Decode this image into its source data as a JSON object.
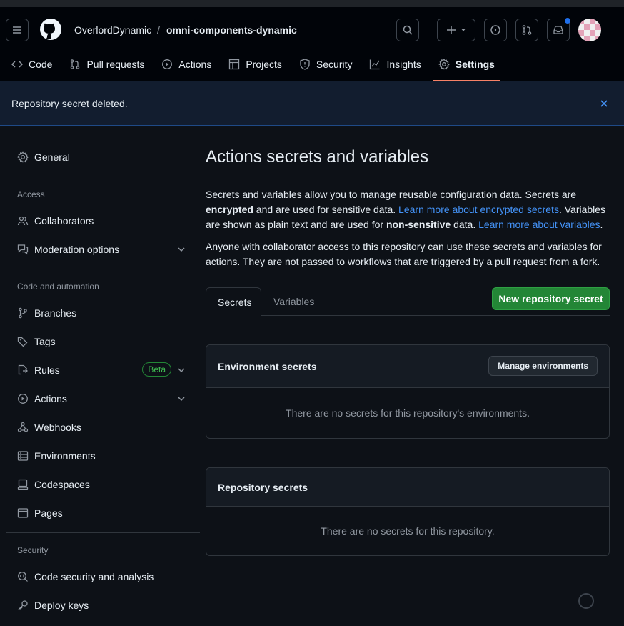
{
  "header": {
    "owner": "OverlordDynamic",
    "separator": "/",
    "repo": "omni-components-dynamic",
    "tabs": [
      {
        "label": "Code",
        "icon": "code-icon"
      },
      {
        "label": "Pull requests",
        "icon": "pull-request-icon"
      },
      {
        "label": "Actions",
        "icon": "play-icon"
      },
      {
        "label": "Projects",
        "icon": "table-icon"
      },
      {
        "label": "Security",
        "icon": "shield-icon"
      },
      {
        "label": "Insights",
        "icon": "graph-icon"
      },
      {
        "label": "Settings",
        "icon": "gear-icon"
      }
    ],
    "active_tab": "Settings"
  },
  "flash": {
    "message": "Repository secret deleted."
  },
  "sidebar": {
    "general": "General",
    "section_access": "Access",
    "collaborators": "Collaborators",
    "moderation": "Moderation options",
    "section_code": "Code and automation",
    "branches": "Branches",
    "tags": "Tags",
    "rules": "Rules",
    "beta": "Beta",
    "actions": "Actions",
    "webhooks": "Webhooks",
    "environments": "Environments",
    "codespaces": "Codespaces",
    "pages": "Pages",
    "section_security": "Security",
    "code_security": "Code security and analysis",
    "deploy_keys": "Deploy keys"
  },
  "main": {
    "title": "Actions secrets and variables",
    "p1_a": "Secrets and variables allow you to manage reusable configuration data. Secrets are ",
    "p1_b": "encrypted",
    "p1_c": " and are used for sensitive data. ",
    "p1_link1": "Learn more about encrypted secrets",
    "p1_d": ". Variables are shown as plain text and are used for ",
    "p1_e": "non-sensitive",
    "p1_f": " data. ",
    "p1_link2": "Learn more about variables",
    "p1_g": ".",
    "p2": "Anyone with collaborator access to this repository can use these secrets and variables for actions. They are not passed to workflows that are triggered by a pull request from a fork.",
    "tab_secrets": "Secrets",
    "tab_variables": "Variables",
    "new_secret": "New repository secret",
    "env_title": "Environment secrets",
    "manage_env": "Manage environments",
    "env_empty": "There are no secrets for this repository's environments.",
    "repo_title": "Repository secrets",
    "repo_empty": "There are no secrets for this repository."
  },
  "colors": {
    "accent_tab": "#f78166",
    "link": "#4493f8",
    "primary_button": "#238636",
    "notification_dot": "#1f6feb"
  }
}
